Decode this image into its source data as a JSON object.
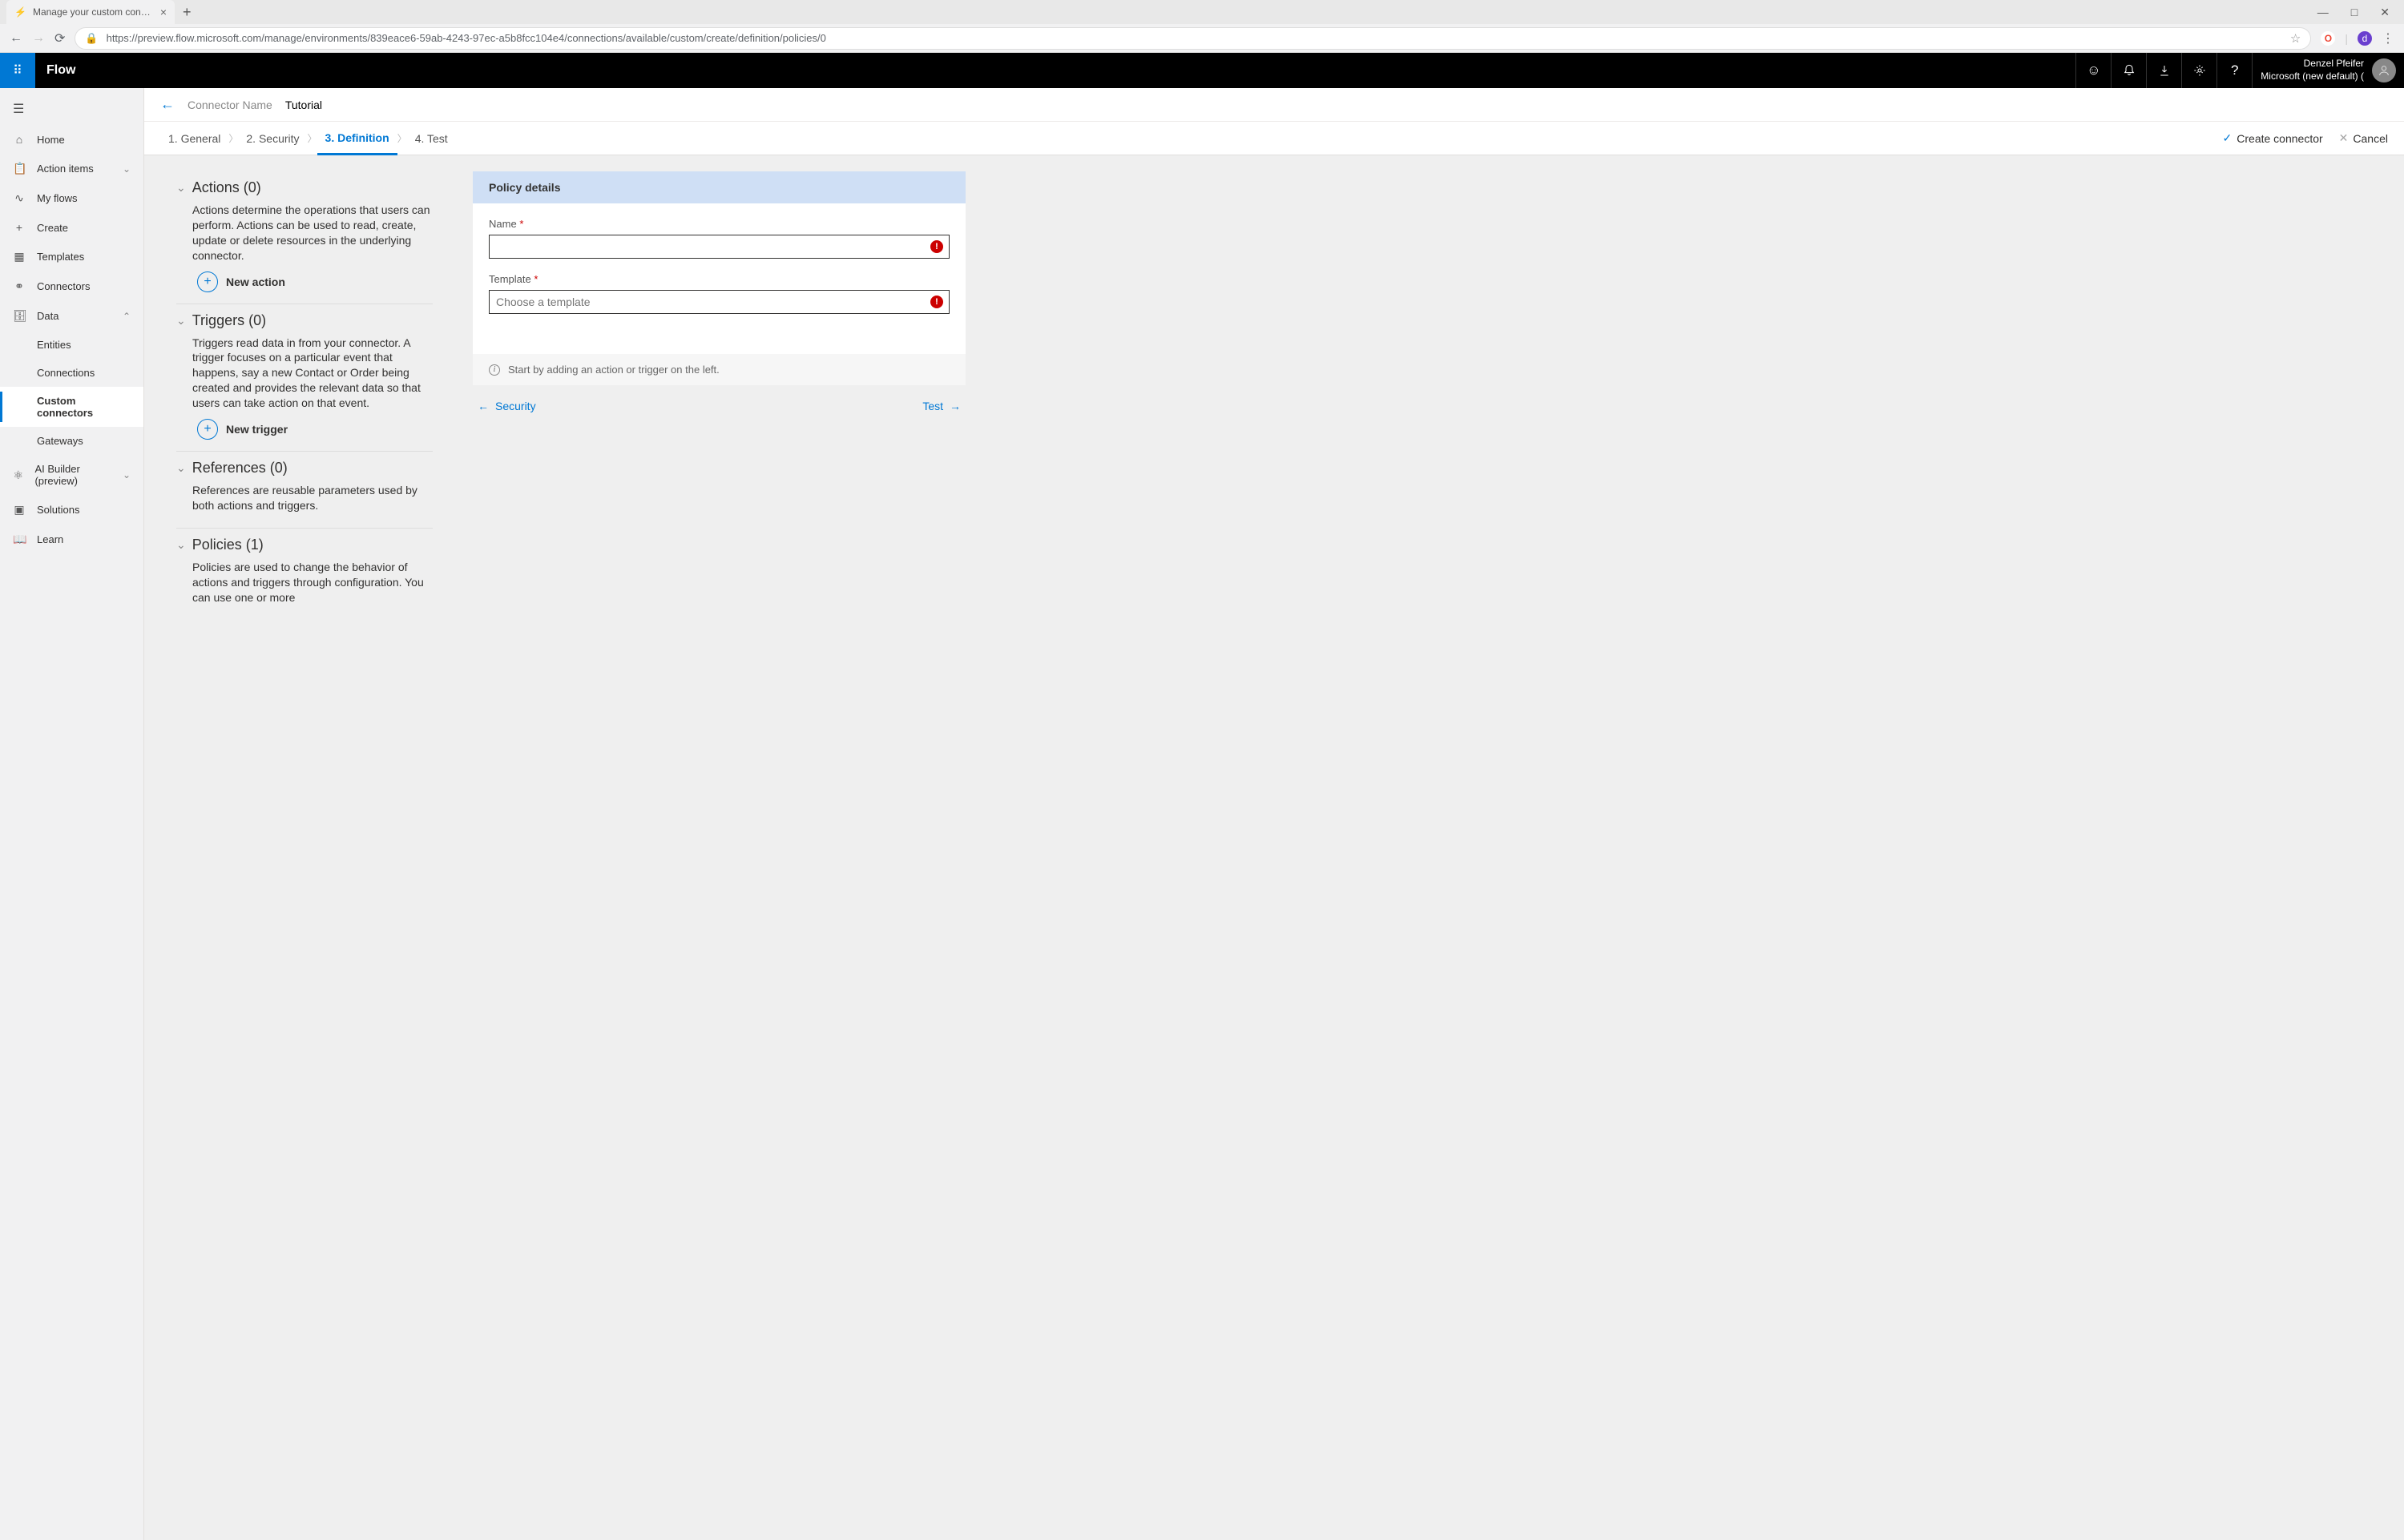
{
  "browser": {
    "tab_title": "Manage your custom connectors",
    "url": "https://preview.flow.microsoft.com/manage/environments/839eace6-59ab-4243-97ec-a5b8fcc104e4/connections/available/custom/create/definition/policies/0"
  },
  "header": {
    "app_name": "Flow",
    "user_name": "Denzel Pfeifer",
    "tenant": "Microsoft (new default) ("
  },
  "sidebar": {
    "home": "Home",
    "action_items": "Action items",
    "my_flows": "My flows",
    "create": "Create",
    "templates": "Templates",
    "connectors": "Connectors",
    "data": "Data",
    "entities": "Entities",
    "connections": "Connections",
    "custom_connectors": "Custom connectors",
    "gateways": "Gateways",
    "ai_builder": "AI Builder (preview)",
    "solutions": "Solutions",
    "learn": "Learn"
  },
  "connector": {
    "label": "Connector Name",
    "value": "Tutorial"
  },
  "steps": {
    "s1": "1. General",
    "s2": "2. Security",
    "s3": "3. Definition",
    "s4": "4. Test",
    "create": "Create connector",
    "cancel": "Cancel"
  },
  "sections": {
    "actions": {
      "title": "Actions (0)",
      "desc": "Actions determine the operations that users can perform. Actions can be used to read, create, update or delete resources in the underlying connector.",
      "add": "New action"
    },
    "triggers": {
      "title": "Triggers (0)",
      "desc": "Triggers read data in from your connector. A trigger focuses on a particular event that happens, say a new Contact or Order being created and provides the relevant data so that users can take action on that event.",
      "add": "New trigger"
    },
    "references": {
      "title": "References (0)",
      "desc": "References are reusable parameters used by both actions and triggers."
    },
    "policies": {
      "title": "Policies (1)",
      "desc": "Policies are used to change the behavior of actions and triggers through configuration. You can use one or more"
    }
  },
  "panel": {
    "title": "Policy details",
    "name_label": "Name",
    "name_value": "",
    "template_label": "Template",
    "template_placeholder": "Choose a template",
    "hint": "Start by adding an action or trigger on the left."
  },
  "footer": {
    "prev": "Security",
    "next": "Test"
  }
}
